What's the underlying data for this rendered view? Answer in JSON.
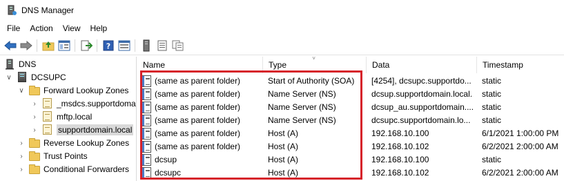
{
  "window": {
    "title": "DNS Manager"
  },
  "menubar": {
    "items": [
      "File",
      "Action",
      "View",
      "Help"
    ]
  },
  "toolbar": {
    "buttons": [
      "back-icon",
      "forward-icon",
      "up-folder-icon",
      "show-hide-tree-icon",
      "export-list-icon",
      "help-icon",
      "properties-icon",
      "server-icon",
      "list-icon",
      "copy-icon"
    ]
  },
  "tree": {
    "items": [
      {
        "label": "DNS"
      },
      {
        "label": "DCSUPC"
      },
      {
        "label": "Forward Lookup Zones"
      },
      {
        "label": "_msdcs.supportdomain.local"
      },
      {
        "label": "mftp.local"
      },
      {
        "label": "supportdomain.local"
      },
      {
        "label": "Reverse Lookup Zones"
      },
      {
        "label": "Trust Points"
      },
      {
        "label": "Conditional Forwarders"
      }
    ]
  },
  "table": {
    "columns": [
      "Name",
      "Type",
      "Data",
      "Timestamp"
    ],
    "rows": [
      {
        "name": "(same as parent folder)",
        "type": "Start of Authority (SOA)",
        "data": "[4254], dcsupc.supportdo...",
        "timestamp": "static"
      },
      {
        "name": "(same as parent folder)",
        "type": "Name Server (NS)",
        "data": "dcsup.supportdomain.local.",
        "timestamp": "static"
      },
      {
        "name": "(same as parent folder)",
        "type": "Name Server (NS)",
        "data": "dcsup_au.supportdomain....",
        "timestamp": "static"
      },
      {
        "name": "(same as parent folder)",
        "type": "Name Server (NS)",
        "data": "dcsupc.supportdomain.lo...",
        "timestamp": "static"
      },
      {
        "name": "(same as parent folder)",
        "type": "Host (A)",
        "data": "192.168.10.100",
        "timestamp": "6/1/2021 1:00:00 PM"
      },
      {
        "name": "(same as parent folder)",
        "type": "Host (A)",
        "data": "192.168.10.102",
        "timestamp": "6/2/2021 2:00:00 AM"
      },
      {
        "name": "dcsup",
        "type": "Host (A)",
        "data": "192.168.10.100",
        "timestamp": "static"
      },
      {
        "name": "dcsupc",
        "type": "Host (A)",
        "data": "192.168.10.102",
        "timestamp": "6/2/2021 2:00:00 AM"
      }
    ]
  },
  "colors": {
    "highlight": "#d6202a",
    "selection": "#d9d9d9"
  }
}
